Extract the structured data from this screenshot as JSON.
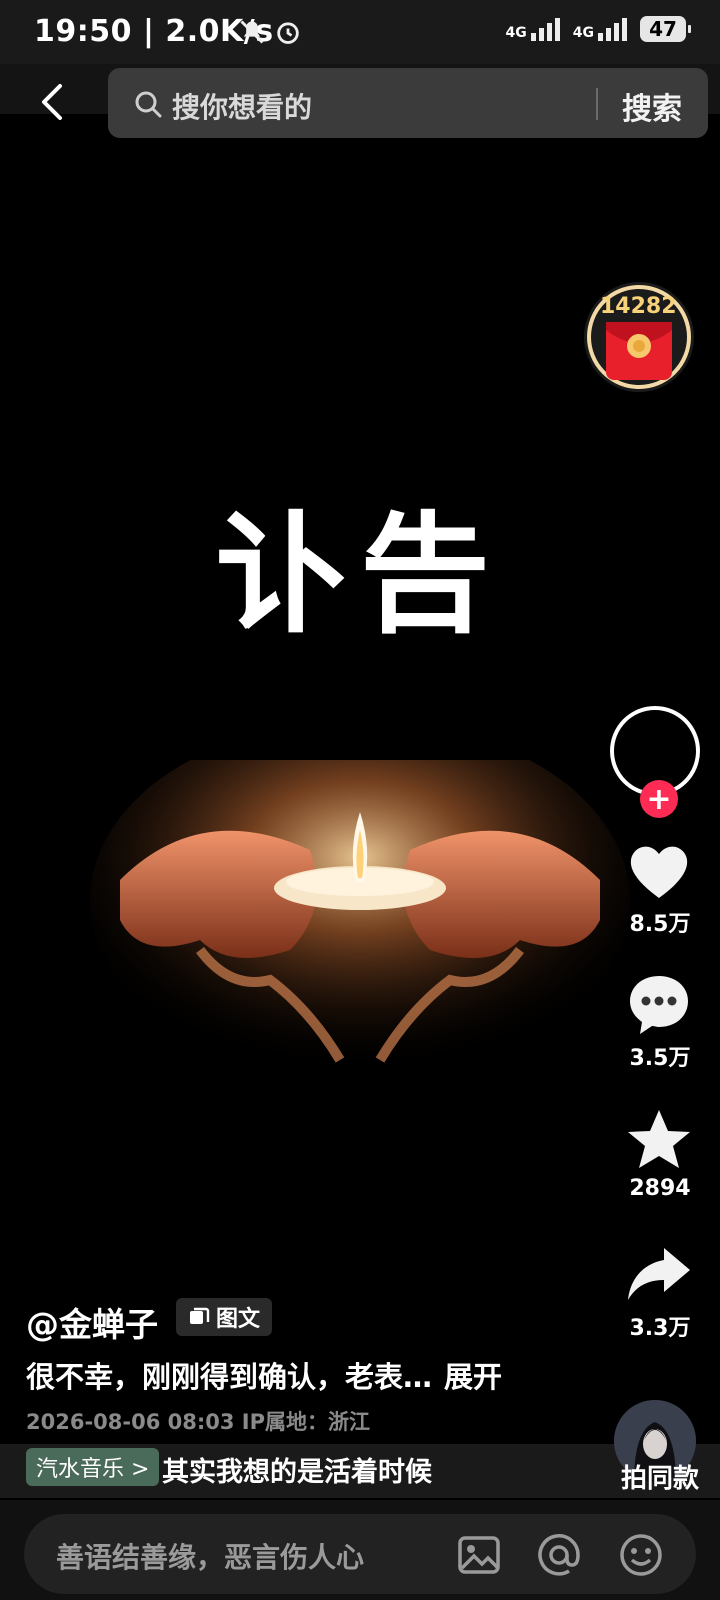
{
  "status_bar": {
    "time": "19:50",
    "speed": "| 2.0K/s",
    "network": "4G",
    "battery": "47"
  },
  "nav": {
    "search_placeholder": "搜你想看的",
    "search_button": "搜索"
  },
  "reward": {
    "count": "14282"
  },
  "post": {
    "headline": "讣告",
    "author": "@金蝉子",
    "type_tag": "图文",
    "caption": "很不幸，刚刚得到确认，老表…",
    "expand": "展开",
    "meta": "2026-08-06 08:03  IP属地：浙江"
  },
  "actions": {
    "likes": "8.5万",
    "comments": "3.5万",
    "favorites": "2894",
    "shares": "3.3万",
    "same_style": "拍同款"
  },
  "music": {
    "chip": "汽水音乐 >",
    "title": "其实我想的是活着时候"
  },
  "comment_input": {
    "placeholder": "善语结善缘，恶言伤人心"
  },
  "colors": {
    "accent": "#fe2c55",
    "reward_gold": "#f7d27a",
    "background": "#000000"
  },
  "icons": [
    "back-chevron-icon",
    "search-icon",
    "red-packet-icon",
    "heart-icon",
    "comment-icon",
    "star-icon",
    "share-icon",
    "image-icon",
    "at-icon",
    "emoji-icon",
    "gallery-icon"
  ]
}
